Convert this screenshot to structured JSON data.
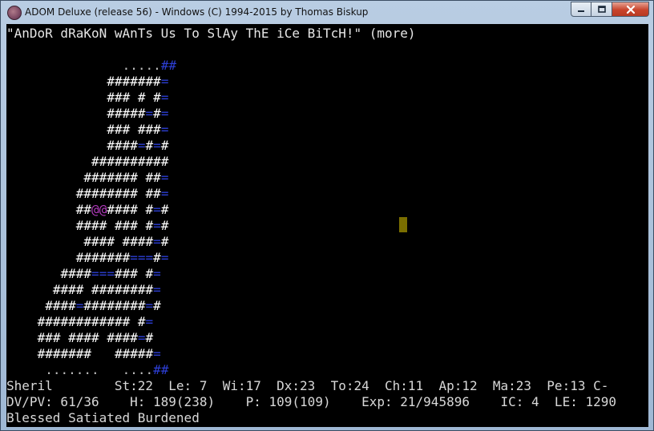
{
  "window": {
    "title": "ADOM Deluxe (release 56) - Windows (C) 1994-2015 by Thomas Biskup",
    "app_icon": "adom-app-icon",
    "controls": [
      "minimize-icon",
      "maximize-icon",
      "close-icon"
    ]
  },
  "message_line": "\"AnDoR dRaKoN wAnTs Us To SlAy ThE iCe BiTcH!\" (more)",
  "map": {
    "rows": [
      "               .....##",
      "             #######=",
      "             ### # #=",
      "             #####=#=",
      "             ### ###=",
      "             ####=#=#",
      "           ##########",
      "          ####### ##=",
      "         ######## ##=",
      "         ##@@#### #=#",
      "         #### ### #=#",
      "          #### ####=#",
      "         #######===#=",
      "       ####===### #=",
      "      #### ########=",
      "     ####=########=#",
      "    ############ #=",
      "    ### #### ####=#",
      "    #######   #####=",
      "     .......   ....##"
    ],
    "colors": {
      "wall": "#ffffff",
      "water": "#2d3fd6",
      "player": "#b23bbd",
      "floor": "#bfbfbf",
      "cursor": "#7a6e00"
    }
  },
  "status": {
    "line1": "Sheril        St:22  Le: 7  Wi:17  Dx:23  To:24  Ch:11  Ap:12  Ma:23  Pe:13 C-",
    "line2": "DV/PV: 61/36    H: 189(238)    P: 109(109)    Exp: 21/945896    IC: 4  LE: 1290",
    "line3": "Blessed Satiated Burdened"
  }
}
